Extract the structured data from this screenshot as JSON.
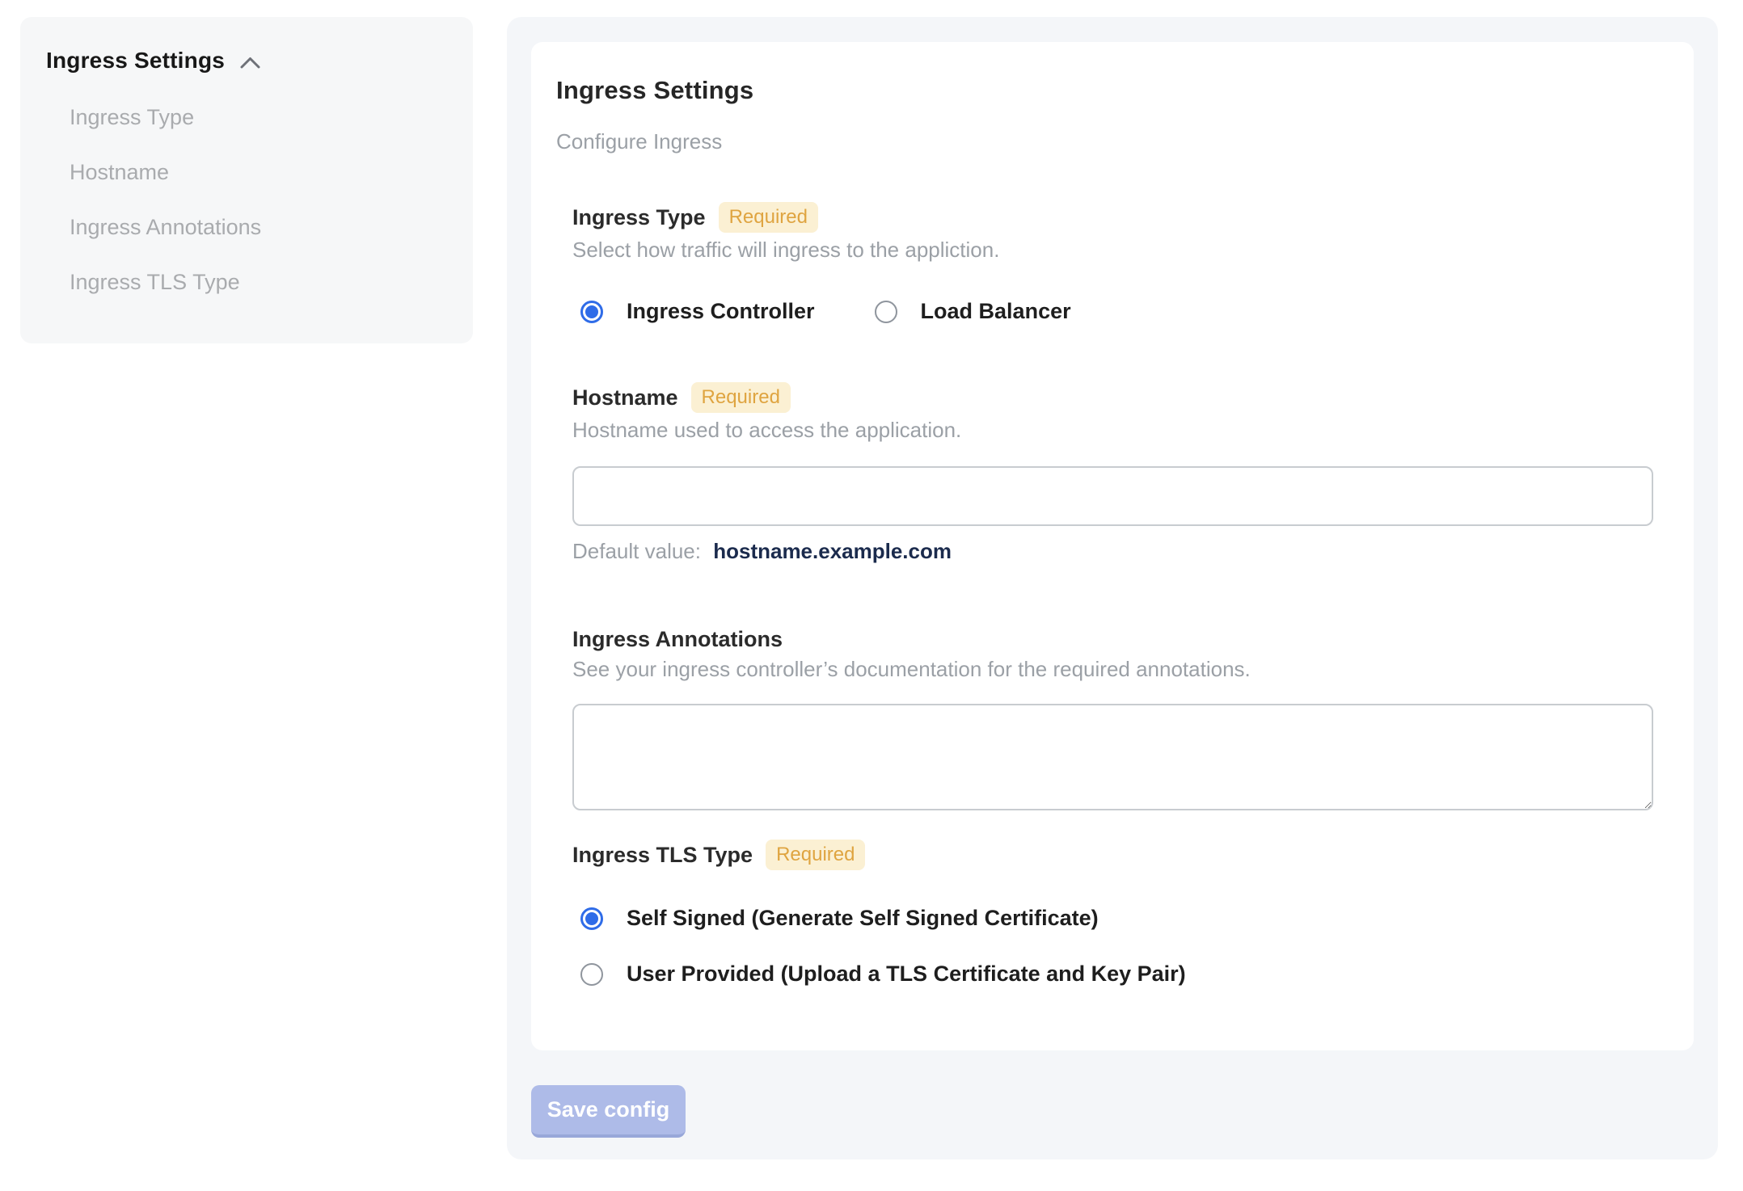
{
  "sidebar": {
    "title": "Ingress Settings",
    "collapse_icon": "chevron-up",
    "items": [
      {
        "label": "Ingress Type"
      },
      {
        "label": "Hostname"
      },
      {
        "label": "Ingress Annotations"
      },
      {
        "label": "Ingress TLS Type"
      }
    ]
  },
  "main": {
    "title": "Ingress Settings",
    "subtitle": "Configure Ingress",
    "sections": {
      "ingress_type": {
        "label": "Ingress Type",
        "required_badge": "Required",
        "description": "Select how traffic will ingress to the appliction.",
        "options": [
          {
            "label": "Ingress Controller",
            "selected": true
          },
          {
            "label": "Load Balancer",
            "selected": false
          }
        ]
      },
      "hostname": {
        "label": "Hostname",
        "required_badge": "Required",
        "description": "Hostname used to access the application.",
        "input_value": "",
        "default_value_label": "Default value:",
        "default_value": "hostname.example.com"
      },
      "annotations": {
        "label": "Ingress Annotations",
        "description": "See your ingress controller’s documentation for the required annotations.",
        "textarea_value": ""
      },
      "tls": {
        "label": "Ingress TLS Type",
        "required_badge": "Required",
        "options": [
          {
            "label": "Self Signed (Generate Self Signed Certificate)",
            "selected": true
          },
          {
            "label": "User Provided (Upload a TLS Certificate and Key Pair)",
            "selected": false
          }
        ]
      }
    },
    "save_button_label": "Save config"
  },
  "colors": {
    "accent_blue": "#2f6ce8",
    "badge_bg": "#fbf0d3",
    "badge_text": "#dfa440",
    "save_button_bg": "#aebbe8",
    "default_value_text": "#1b2b4d",
    "sidebar_bg": "#f6f7f8",
    "main_container_bg": "#f4f6f9"
  }
}
